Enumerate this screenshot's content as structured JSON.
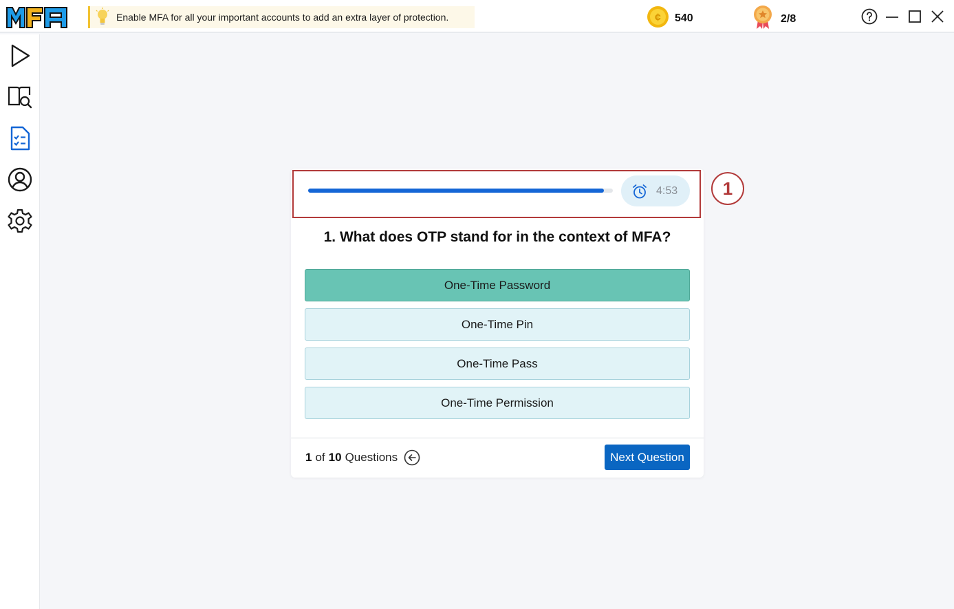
{
  "app": {
    "logo_text": "MFA",
    "tip_text": "Enable MFA for all your important accounts to add an extra layer of protection.",
    "coins": "540",
    "badges": "2/8"
  },
  "sidebar": {
    "items": [
      {
        "name": "play",
        "icon": "play-icon"
      },
      {
        "name": "book-search",
        "icon": "book-search-icon"
      },
      {
        "name": "quiz",
        "icon": "checklist-icon",
        "active": true
      },
      {
        "name": "profile",
        "icon": "user-circle-icon"
      },
      {
        "name": "settings",
        "icon": "gear-icon"
      }
    ]
  },
  "quiz": {
    "progress_percent": 97,
    "timer": "4:53",
    "question": "1. What does OTP stand for in the context of MFA?",
    "options": [
      {
        "label": "One-Time Password",
        "selected": true
      },
      {
        "label": "One-Time Pin",
        "selected": false
      },
      {
        "label": "One-Time Pass",
        "selected": false
      },
      {
        "label": "One-Time Permission",
        "selected": false
      }
    ],
    "counter_current": "1",
    "counter_of": "of",
    "counter_total": "10",
    "counter_label": "Questions",
    "next_label": "Next Question"
  },
  "annotation": {
    "marker": "1"
  },
  "colors": {
    "accent": "#0a66c2",
    "selected_option": "#68c4b4",
    "option_bg": "#e1f3f7",
    "highlight": "#b23a3a",
    "active_nav": "#1466d6"
  }
}
